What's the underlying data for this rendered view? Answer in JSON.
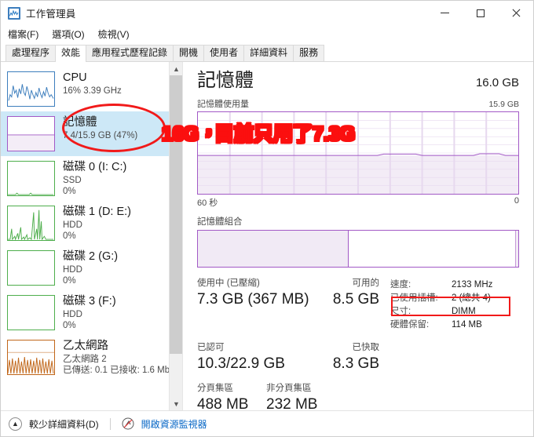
{
  "window": {
    "title": "工作管理員",
    "icon": "task-manager-icon",
    "minimize": "–",
    "maximize": "□",
    "close": "✕"
  },
  "menu": {
    "items": [
      {
        "label": "檔案(F)",
        "name": "menu-file"
      },
      {
        "label": "選項(O)",
        "name": "menu-options"
      },
      {
        "label": "檢視(V)",
        "name": "menu-view"
      }
    ]
  },
  "tabs": [
    {
      "label": "處理程序",
      "active": false
    },
    {
      "label": "效能",
      "active": true
    },
    {
      "label": "應用程式歷程記錄",
      "active": false
    },
    {
      "label": "開機",
      "active": false
    },
    {
      "label": "使用者",
      "active": false
    },
    {
      "label": "詳細資料",
      "active": false
    },
    {
      "label": "服務",
      "active": false
    }
  ],
  "sidebar": {
    "items": [
      {
        "title": "CPU",
        "line2": "16%  3.39 GHz",
        "line3": "",
        "color": "#3d7ebd",
        "selected": false
      },
      {
        "title": "記憶體",
        "line2": "7.4/15.9 GB (47%)",
        "line3": "",
        "color": "#a259c6",
        "selected": true
      },
      {
        "title": "磁碟 0 (I: C:)",
        "line2": "SSD",
        "line3": "0%",
        "color": "#4eae4c",
        "selected": false
      },
      {
        "title": "磁碟 1 (D: E:)",
        "line2": "HDD",
        "line3": "0%",
        "color": "#4eae4c",
        "selected": false
      },
      {
        "title": "磁碟 2 (G:)",
        "line2": "HDD",
        "line3": "0%",
        "color": "#4eae4c",
        "selected": false
      },
      {
        "title": "磁碟 3 (F:)",
        "line2": "HDD",
        "line3": "0%",
        "color": "#4eae4c",
        "selected": false
      },
      {
        "title": "乙太網路",
        "line2": "乙太網路 2",
        "line3": "已傳送: 0.1 已接收: 1.6 Mb",
        "color": "#c1671a",
        "selected": false
      }
    ]
  },
  "main": {
    "title": "記憶體",
    "total": "16.0 GB",
    "graph": {
      "caption": "記憶體使用量",
      "max_label": "15.9 GB",
      "axis_left": "60 秒",
      "axis_right": "0",
      "used_percent": 47
    },
    "composition": {
      "label": "記憶體組合",
      "used_percent": 47
    },
    "stats": {
      "in_use_label": "使用中 (已壓縮)",
      "in_use_value": "7.3 GB (367 MB)",
      "available_label": "可用的",
      "available_value": "8.5 GB",
      "committed_label": "已認可",
      "committed_value": "10.3/22.9 GB",
      "cached_label": "已快取",
      "cached_value": "8.3 GB",
      "paged_label": "分頁集區",
      "paged_value": "488 MB",
      "nonpaged_label": "非分頁集區",
      "nonpaged_value": "232 MB"
    },
    "details": [
      {
        "key": "速度:",
        "value": "2133 MHz"
      },
      {
        "key": "已使用插槽:",
        "value": "2 (總共 4)"
      },
      {
        "key": "尺寸:",
        "value": "DIMM"
      },
      {
        "key": "硬體保留:",
        "value": "114 MB"
      }
    ]
  },
  "statusbar": {
    "fewer_details": "較少詳細資料(D)",
    "open_resource_monitor": "開啟資源監視器"
  },
  "annotations": {
    "text_16g": "16G，",
    "text_current": "目前只用了7.3G",
    "color": "#fb0f0f"
  }
}
